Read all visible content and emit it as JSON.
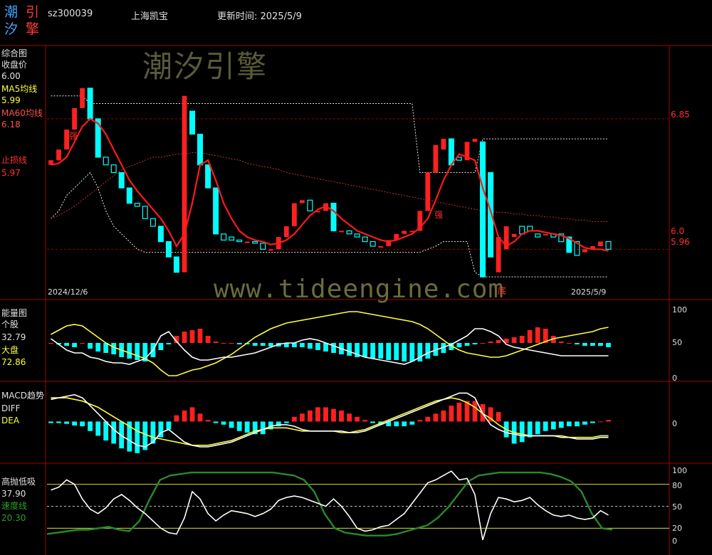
{
  "header": {
    "logo_chars": [
      "潮",
      "引",
      "汐",
      "擎"
    ],
    "code": "sz300039",
    "name": "上海凯宝",
    "update_label": "更新时间: 2025/5/9"
  },
  "watermarks": {
    "brand": "潮汐引擎",
    "url": "www.tideengine.com"
  },
  "colors": {
    "up": "#ff2020",
    "down": "#00ffff",
    "ma5": "#ffff40",
    "ma60": "#ff3030",
    "grid": "#a00000",
    "speed": "#2a8a2a"
  },
  "panels": {
    "main": {
      "title": "综合图",
      "close_label": "收盘价",
      "close_value": "6.00",
      "ma5_label": "MA5均线",
      "ma5_value": "5.99",
      "ma60_label": "MA60均线",
      "ma60_value": "6.18",
      "stop_label": "止损线",
      "stop_value": "5.97",
      "date_start": "2024/12/6",
      "date_end": "2025/5/9",
      "right_labels": [
        "6.85",
        "6.0",
        "5.96"
      ],
      "marks": [
        "强",
        "强",
        "底"
      ]
    },
    "energy": {
      "title": "能量图",
      "stock_label": "个股",
      "stock_value": "32.79",
      "market_label": "大盘",
      "market_value": "72.86",
      "axis": [
        "100",
        "50",
        "0"
      ]
    },
    "macd": {
      "title": "MACD趋势",
      "diff_label": "DIFF",
      "dea_label": "DEA",
      "axis": [
        "0"
      ]
    },
    "kdj": {
      "title": "高抛低吸",
      "value": "37.90",
      "speed_label": "速度线",
      "speed_value": "20.30",
      "axis": [
        "100",
        "80",
        "50",
        "20",
        "0"
      ]
    }
  },
  "chart_data": {
    "type": "candlestick",
    "note_x": "trading days 2024/12/6 to 2025/5/9",
    "price": {
      "ylim": [
        5.7,
        7.3
      ],
      "open": [
        6.55,
        6.58,
        6.65,
        6.78,
        6.92,
        7.05,
        6.85,
        6.6,
        6.55,
        6.5,
        6.4,
        6.3,
        6.28,
        6.2,
        6.15,
        6.05,
        5.95,
        5.85,
        6.9,
        6.75,
        6.55,
        6.4,
        6.1,
        6.08,
        6.06,
        6.05,
        6.05,
        6.04,
        6.0,
        6.0,
        6.08,
        6.15,
        6.3,
        6.32,
        6.25,
        6.25,
        6.3,
        6.12,
        6.12,
        6.1,
        6.08,
        6.05,
        6.02,
        6.02,
        6.06,
        6.1,
        6.12,
        6.12,
        6.25,
        6.5,
        6.65,
        6.72,
        6.6,
        6.58,
        6.7,
        6.7,
        6.5,
        5.85,
        6.0,
        6.08,
        6.15,
        6.15,
        6.1,
        6.1,
        6.1,
        6.1,
        6.08,
        6.05,
        5.98,
        6.0,
        6.02,
        6.05
      ],
      "close": [
        6.58,
        6.65,
        6.78,
        6.92,
        7.05,
        6.85,
        6.6,
        6.55,
        6.5,
        6.4,
        6.3,
        6.28,
        6.2,
        6.15,
        6.05,
        5.95,
        5.85,
        7.0,
        6.75,
        6.55,
        6.4,
        6.1,
        6.06,
        6.06,
        6.05,
        6.05,
        6.04,
        6.0,
        6.0,
        6.08,
        6.15,
        6.3,
        6.32,
        6.25,
        6.25,
        6.3,
        6.12,
        6.12,
        6.1,
        6.08,
        6.05,
        6.02,
        6.02,
        6.06,
        6.1,
        6.12,
        6.12,
        6.25,
        6.5,
        6.68,
        6.72,
        6.55,
        6.58,
        6.7,
        6.72,
        5.82,
        5.95,
        6.08,
        6.15,
        6.1,
        6.1,
        6.12,
        6.08,
        6.1,
        6.08,
        6.05,
        5.98,
        5.96,
        6.0,
        6.02,
        6.05,
        6.0
      ],
      "ma5": [
        6.55,
        6.56,
        6.6,
        6.7,
        6.8,
        6.85,
        6.82,
        6.75,
        6.65,
        6.55,
        6.45,
        6.38,
        6.32,
        6.26,
        6.2,
        6.12,
        6.02,
        6.1,
        6.3,
        6.55,
        6.58,
        6.45,
        6.3,
        6.2,
        6.12,
        6.08,
        6.06,
        6.05,
        6.03,
        6.04,
        6.06,
        6.1,
        6.16,
        6.22,
        6.26,
        6.28,
        6.25,
        6.2,
        6.16,
        6.12,
        6.1,
        6.08,
        6.06,
        6.05,
        6.06,
        6.08,
        6.1,
        6.14,
        6.2,
        6.32,
        6.45,
        6.55,
        6.62,
        6.6,
        6.58,
        6.4,
        6.25,
        6.08,
        6.02,
        6.05,
        6.1,
        6.12,
        6.12,
        6.11,
        6.1,
        6.09,
        6.07,
        6.04,
        6.01,
        6.0,
        6.0,
        5.99
      ],
      "ma60": [
        6.2,
        6.22,
        6.25,
        6.28,
        6.32,
        6.36,
        6.4,
        6.44,
        6.48,
        6.52,
        6.54,
        6.56,
        6.58,
        6.6,
        6.6,
        6.61,
        6.62,
        6.62,
        6.63,
        6.63,
        6.62,
        6.61,
        6.6,
        6.59,
        6.58,
        6.56,
        6.55,
        6.54,
        6.53,
        6.52,
        6.5,
        6.49,
        6.48,
        6.47,
        6.46,
        6.45,
        6.44,
        6.43,
        6.42,
        6.41,
        6.4,
        6.39,
        6.38,
        6.37,
        6.36,
        6.35,
        6.34,
        6.33,
        6.32,
        6.31,
        6.3,
        6.29,
        6.28,
        6.27,
        6.26,
        6.25,
        6.25,
        6.24,
        6.24,
        6.23,
        6.23,
        6.22,
        6.22,
        6.21,
        6.21,
        6.2,
        6.2,
        6.19,
        6.19,
        6.18,
        6.18,
        6.18
      ],
      "band_upper": [
        7.0,
        7.0,
        7.0,
        7.0,
        7.0,
        6.95,
        6.95,
        6.95,
        6.95,
        6.95,
        6.95,
        6.95,
        6.95,
        6.95,
        6.95,
        6.95,
        6.95,
        6.95,
        6.95,
        6.95,
        6.95,
        6.95,
        6.95,
        6.95,
        6.95,
        6.95,
        6.95,
        6.95,
        6.95,
        6.95,
        6.95,
        6.95,
        6.95,
        6.95,
        6.95,
        6.95,
        6.95,
        6.95,
        6.95,
        6.95,
        6.95,
        6.95,
        6.95,
        6.95,
        6.95,
        6.95,
        6.95,
        6.5,
        6.5,
        6.5,
        6.5,
        6.5,
        6.5,
        6.5,
        6.5,
        6.72,
        6.72,
        6.72,
        6.72,
        6.72,
        6.72,
        6.72,
        6.72,
        6.72,
        6.72,
        6.72,
        6.72,
        6.72,
        6.72,
        6.72,
        6.72,
        6.72
      ],
      "band_lower": [
        6.2,
        6.25,
        6.35,
        6.4,
        6.45,
        6.5,
        6.4,
        6.25,
        6.15,
        6.1,
        6.05,
        6.0,
        5.98,
        5.98,
        5.98,
        5.98,
        5.98,
        5.98,
        5.98,
        5.98,
        5.98,
        5.98,
        5.98,
        5.98,
        5.98,
        5.98,
        5.98,
        5.98,
        5.98,
        5.98,
        5.98,
        5.98,
        5.98,
        5.98,
        5.98,
        5.98,
        5.98,
        5.98,
        5.98,
        5.98,
        5.98,
        5.98,
        5.98,
        5.98,
        5.98,
        5.98,
        5.98,
        5.98,
        6.0,
        6.02,
        6.05,
        6.05,
        6.05,
        6.05,
        5.85,
        5.82,
        5.82,
        5.82,
        5.82,
        5.82,
        5.82,
        5.82,
        5.82,
        5.82,
        5.82,
        5.82,
        5.82,
        5.82,
        5.82,
        5.82,
        5.82,
        5.82
      ]
    },
    "energy": {
      "ylim": [
        0,
        100
      ],
      "bars": [
        50,
        48,
        46,
        44,
        50,
        42,
        38,
        36,
        34,
        30,
        28,
        26,
        24,
        30,
        40,
        48,
        60,
        66,
        68,
        70,
        60,
        52,
        50,
        50,
        48,
        48,
        46,
        46,
        45,
        45,
        44,
        44,
        44,
        42,
        40,
        38,
        36,
        34,
        32,
        30,
        30,
        28,
        28,
        26,
        26,
        24,
        24,
        24,
        28,
        32,
        36,
        40,
        44,
        46,
        48,
        50,
        52,
        54,
        56,
        58,
        60,
        68,
        72,
        70,
        60,
        52,
        50,
        48,
        46,
        46,
        46,
        44
      ],
      "stock": [
        56,
        48,
        40,
        36,
        36,
        30,
        28,
        24,
        22,
        22,
        20,
        24,
        28,
        40,
        60,
        66,
        52,
        40,
        30,
        26,
        26,
        28,
        30,
        30,
        32,
        34,
        36,
        40,
        44,
        48,
        50,
        50,
        54,
        56,
        54,
        50,
        46,
        42,
        38,
        34,
        30,
        28,
        26,
        24,
        22,
        20,
        24,
        30,
        36,
        40,
        44,
        48,
        54,
        60,
        70,
        70,
        66,
        60,
        48,
        44,
        42,
        40,
        38,
        36,
        34,
        32,
        32,
        32,
        32,
        32,
        32,
        32
      ],
      "market": [
        62,
        68,
        74,
        76,
        74,
        66,
        58,
        50,
        44,
        40,
        36,
        32,
        28,
        22,
        12,
        4,
        4,
        8,
        12,
        14,
        18,
        22,
        28,
        34,
        42,
        50,
        58,
        64,
        70,
        74,
        78,
        80,
        82,
        84,
        86,
        88,
        90,
        92,
        94,
        94,
        92,
        90,
        88,
        86,
        84,
        82,
        80,
        76,
        70,
        62,
        54,
        46,
        40,
        36,
        34,
        32,
        30,
        30,
        32,
        36,
        40,
        44,
        48,
        52,
        56,
        58,
        60,
        62,
        64,
        66,
        70,
        72
      ]
    },
    "macd": {
      "ylim": [
        -0.5,
        0.4
      ],
      "hist": [
        -0.02,
        -0.02,
        -0.03,
        -0.05,
        -0.06,
        -0.12,
        -0.18,
        -0.24,
        -0.28,
        -0.34,
        -0.38,
        -0.4,
        -0.36,
        -0.28,
        -0.2,
        -0.1,
        0.08,
        0.14,
        0.18,
        0.1,
        0.02,
        -0.02,
        -0.04,
        -0.08,
        -0.12,
        -0.14,
        -0.16,
        -0.16,
        -0.1,
        -0.06,
        -0.02,
        0.06,
        0.1,
        0.14,
        0.18,
        0.18,
        0.16,
        0.14,
        0.1,
        0.06,
        0.02,
        -0.02,
        -0.04,
        -0.06,
        -0.06,
        -0.06,
        -0.04,
        0.02,
        0.06,
        0.1,
        0.14,
        0.2,
        0.24,
        0.26,
        0.26,
        0.22,
        0.18,
        0.12,
        -0.2,
        -0.28,
        -0.26,
        -0.2,
        -0.16,
        -0.12,
        -0.1,
        -0.08,
        -0.06,
        -0.06,
        -0.04,
        -0.02,
        0.0,
        0.02
      ],
      "diff": [
        0.28,
        0.3,
        0.32,
        0.34,
        0.3,
        0.2,
        0.1,
        0.0,
        -0.1,
        -0.18,
        -0.24,
        -0.3,
        -0.32,
        -0.26,
        -0.14,
        -0.1,
        -0.18,
        -0.26,
        -0.3,
        -0.32,
        -0.32,
        -0.3,
        -0.28,
        -0.26,
        -0.22,
        -0.18,
        -0.14,
        -0.1,
        -0.06,
        -0.04,
        -0.04,
        -0.06,
        -0.1,
        -0.12,
        -0.12,
        -0.12,
        -0.12,
        -0.12,
        -0.14,
        -0.14,
        -0.12,
        -0.08,
        -0.04,
        0.0,
        0.04,
        0.08,
        0.12,
        0.16,
        0.2,
        0.24,
        0.28,
        0.32,
        0.36,
        0.36,
        0.3,
        0.1,
        -0.04,
        -0.1,
        -0.14,
        -0.16,
        -0.18,
        -0.18,
        -0.18,
        -0.18,
        -0.18,
        -0.2,
        -0.2,
        -0.22,
        -0.22,
        -0.22,
        -0.2,
        -0.2
      ],
      "dea": [
        0.3,
        0.3,
        0.3,
        0.28,
        0.26,
        0.22,
        0.18,
        0.12,
        0.06,
        0.0,
        -0.06,
        -0.12,
        -0.16,
        -0.2,
        -0.22,
        -0.24,
        -0.26,
        -0.28,
        -0.3,
        -0.3,
        -0.3,
        -0.28,
        -0.26,
        -0.24,
        -0.2,
        -0.16,
        -0.12,
        -0.1,
        -0.08,
        -0.08,
        -0.08,
        -0.1,
        -0.12,
        -0.12,
        -0.12,
        -0.12,
        -0.12,
        -0.14,
        -0.14,
        -0.12,
        -0.1,
        -0.06,
        -0.02,
        0.02,
        0.06,
        0.1,
        0.14,
        0.18,
        0.22,
        0.26,
        0.28,
        0.3,
        0.28,
        0.24,
        0.18,
        0.1,
        0.04,
        -0.04,
        -0.1,
        -0.14,
        -0.16,
        -0.18,
        -0.18,
        -0.18,
        -0.18,
        -0.18,
        -0.2,
        -0.2,
        -0.2,
        -0.2,
        -0.18,
        -0.18
      ]
    },
    "kdj": {
      "ylim": [
        0,
        100
      ],
      "white": [
        72,
        76,
        86,
        80,
        60,
        46,
        40,
        48,
        60,
        66,
        58,
        48,
        40,
        30,
        20,
        14,
        12,
        34,
        70,
        60,
        40,
        30,
        38,
        44,
        42,
        40,
        36,
        40,
        46,
        58,
        62,
        64,
        62,
        58,
        54,
        50,
        60,
        50,
        36,
        20,
        16,
        18,
        22,
        24,
        32,
        40,
        54,
        68,
        82,
        86,
        92,
        98,
        86,
        88,
        66,
        4,
        40,
        62,
        60,
        56,
        58,
        62,
        52,
        44,
        38,
        36,
        38,
        34,
        32,
        34,
        44,
        38
      ],
      "speed": [
        12,
        14,
        16,
        18,
        18,
        20,
        22,
        18,
        16,
        30,
        60,
        86,
        92,
        94,
        96,
        96,
        96,
        96,
        96,
        96,
        96,
        96,
        96,
        94,
        92,
        86,
        70,
        40,
        20,
        14,
        12,
        10,
        10,
        10,
        12,
        16,
        20,
        24,
        34,
        48,
        66,
        84,
        92,
        94,
        96,
        96,
        96,
        96,
        96,
        94,
        90,
        84,
        70,
        40,
        20,
        18
      ],
      "ref_lines": [
        80,
        50,
        20
      ]
    }
  }
}
